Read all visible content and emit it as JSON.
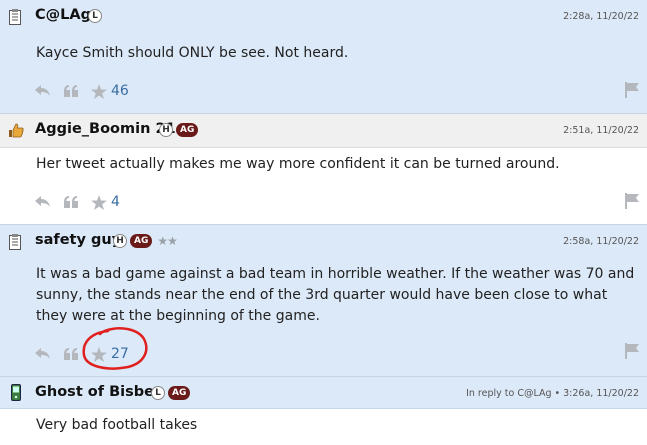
{
  "posts": [
    {
      "username": "C@LAg",
      "badges": [
        "L"
      ],
      "ag_badge": "",
      "stars": "",
      "timestamp": "2:28a, 11/20/22",
      "text": "Kayce Smith should ONLY be see. Not heard.",
      "star_count": "46",
      "avatar_icon": "notepad-icon"
    },
    {
      "username": "Aggie_Boomin 21",
      "badges": [
        "H"
      ],
      "ag_badge": "AG",
      "stars": "",
      "timestamp": "2:51a, 11/20/22",
      "text": "Her tweet actually makes me way more confident it can be turned around.",
      "star_count": "4",
      "avatar_icon": "thumbs-up-icon"
    },
    {
      "username": "safety guy",
      "badges": [
        "H"
      ],
      "ag_badge": "AG",
      "stars": "★★",
      "timestamp": "2:58a, 11/20/22",
      "text": "It was a bad game against a bad team in horrible weather. If the weather was 70 and sunny, the stands near the end of the 3rd quarter would have been close to what they were at the beginning of the game.",
      "star_count": "27",
      "avatar_icon": "notepad-icon"
    },
    {
      "username": "Ghost of Bisbee",
      "badges": [
        "L"
      ],
      "ag_badge": "AG",
      "stars": "",
      "timestamp": "In reply to C@LAg • 3:26a, 11/20/22",
      "text": "Very bad football takes",
      "star_count": "",
      "avatar_icon": "phone-icon"
    }
  ],
  "colors": {
    "header_blue": "#dce9f8",
    "header_gray": "#f0f0f0",
    "ag_badge": "#6b1a1a",
    "count_blue": "#3a6ea5",
    "annotation_red": "#e0201f"
  }
}
